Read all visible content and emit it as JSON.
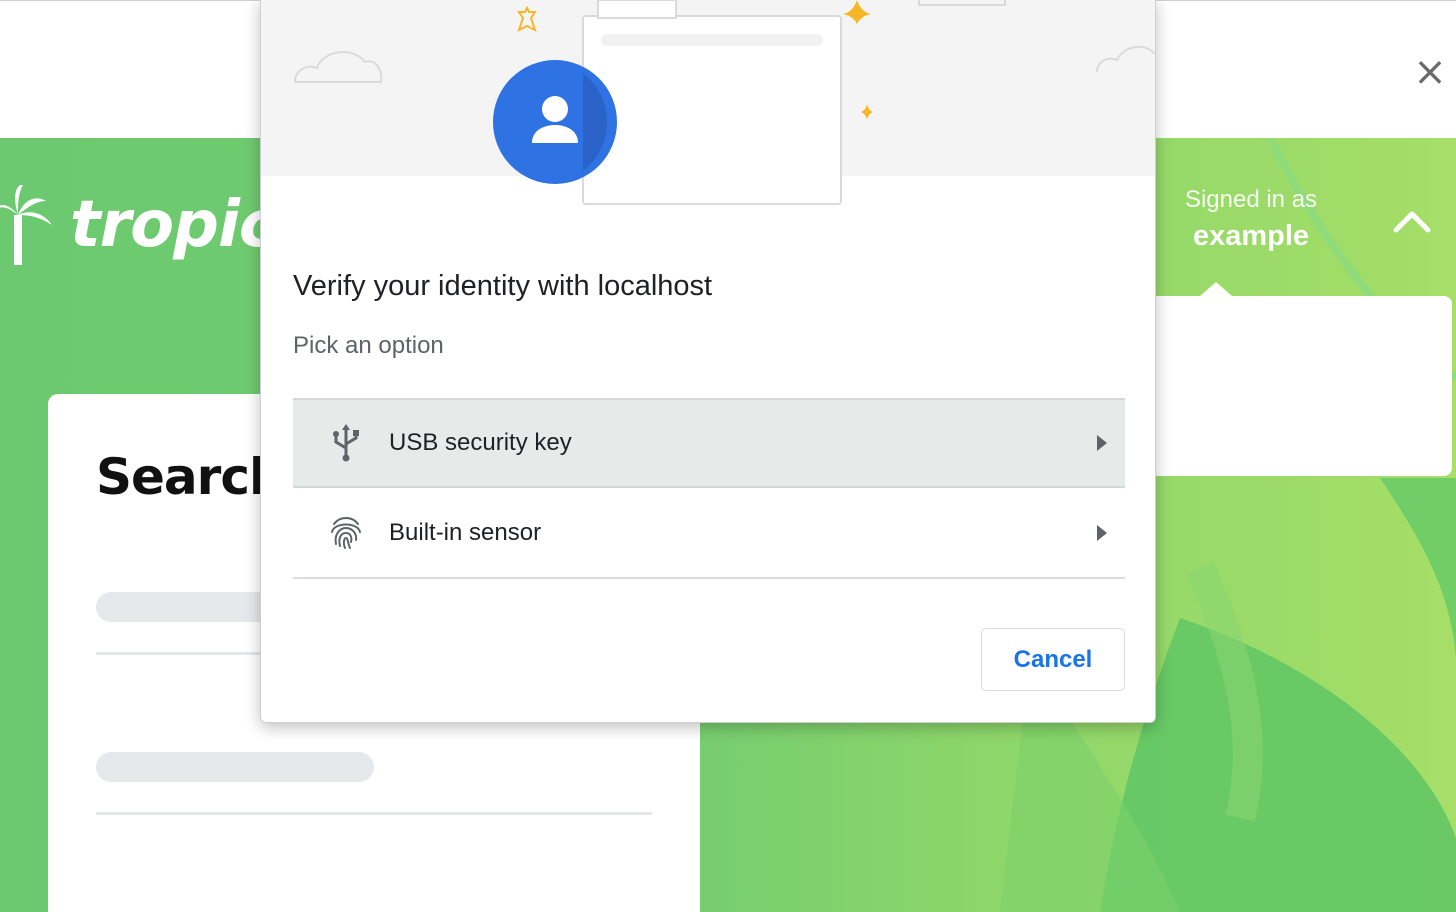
{
  "window": {
    "close_glyph": "×"
  },
  "site": {
    "logo_text": "tropica",
    "signed_in_label": "Signed in as",
    "username": "example",
    "card_title": "Search"
  },
  "dialog": {
    "title": "Verify your identity with localhost",
    "subtitle": "Pick an option",
    "options": [
      {
        "label": "USB security key",
        "icon": "usb-icon",
        "highlighted": true
      },
      {
        "label": "Built-in sensor",
        "icon": "fingerprint-icon",
        "highlighted": false
      }
    ],
    "cancel_label": "Cancel"
  },
  "colors": {
    "accent_blue": "#1a73e8",
    "avatar_blue": "#2f72e3",
    "site_green": "#6cc96f",
    "sparkle_yellow": "#f6b627"
  }
}
